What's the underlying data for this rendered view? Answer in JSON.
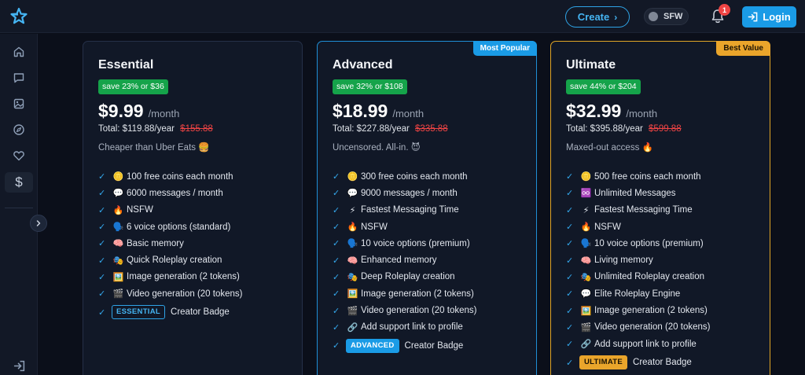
{
  "header": {
    "create_label": "Create",
    "sfw_label": "SFW",
    "notification_count": "1",
    "login_label": "Login"
  },
  "icons": {
    "logo": "star-logo-icon",
    "sidebar": [
      "home-icon",
      "chat-icon",
      "image-icon",
      "compass-icon",
      "heart-icon",
      "dollar-icon"
    ],
    "collapse": "chevron-right-icon",
    "logout": "login-arrow-icon"
  },
  "colors": {
    "accent": "#1a9be6",
    "gold": "#eaa52b",
    "save_green": "#15a34a",
    "strike_red": "#ef4444"
  },
  "plans": [
    {
      "name": "Essential",
      "ribbon": "",
      "save": "save 23% or $36",
      "price": "$9.99",
      "per": "/month",
      "total": "Total: $119.88/year",
      "old_total": "$155.88",
      "tagline": "Cheaper than Uber Eats 🍔",
      "features": [
        {
          "emoji": "🪙",
          "text": "100 free coins each month"
        },
        {
          "emoji": "💬",
          "text": "6000 messages / month"
        },
        {
          "emoji": "🔥",
          "text": "NSFW"
        },
        {
          "emoji": "🗣️",
          "text": "6 voice options (standard)"
        },
        {
          "emoji": "🧠",
          "text": "Basic memory"
        },
        {
          "emoji": "🎭",
          "text": "Quick Roleplay creation"
        },
        {
          "emoji": "🖼️",
          "text": "Image generation (2 tokens)"
        },
        {
          "emoji": "🎬",
          "text": "Video generation (20 tokens)"
        }
      ],
      "badge": "ESSENTIAL",
      "badge_text": "Creator Badge"
    },
    {
      "name": "Advanced",
      "ribbon": "Most Popular",
      "save": "save 32% or $108",
      "price": "$18.99",
      "per": "/month",
      "total": "Total: $227.88/year",
      "old_total": "$335.88",
      "tagline": "Uncensored. All-in. 😈",
      "features": [
        {
          "emoji": "🪙",
          "text": "300 free coins each month"
        },
        {
          "emoji": "💬",
          "text": "9000 messages / month"
        },
        {
          "emoji": "⚡",
          "text": "Fastest Messaging Time"
        },
        {
          "emoji": "🔥",
          "text": "NSFW"
        },
        {
          "emoji": "🗣️",
          "text": "10 voice options (premium)"
        },
        {
          "emoji": "🧠",
          "text": "Enhanced memory"
        },
        {
          "emoji": "🎭",
          "text": "Deep Roleplay creation"
        },
        {
          "emoji": "🖼️",
          "text": "Image generation (2 tokens)"
        },
        {
          "emoji": "🎬",
          "text": "Video generation (20 tokens)"
        },
        {
          "emoji": "🔗",
          "text": "Add support link to profile"
        }
      ],
      "badge": "ADVANCED",
      "badge_text": "Creator Badge"
    },
    {
      "name": "Ultimate",
      "ribbon": "Best Value",
      "save": "save 44% or $204",
      "price": "$32.99",
      "per": "/month",
      "total": "Total: $395.88/year",
      "old_total": "$599.88",
      "tagline": "Maxed-out access 🔥",
      "features": [
        {
          "emoji": "🪙",
          "text": "500 free coins each month"
        },
        {
          "emoji": "♾️",
          "text": "Unlimited Messages"
        },
        {
          "emoji": "⚡",
          "text": "Fastest Messaging Time"
        },
        {
          "emoji": "🔥",
          "text": "NSFW"
        },
        {
          "emoji": "🗣️",
          "text": "10 voice options (premium)"
        },
        {
          "emoji": "🧠",
          "text": "Living memory"
        },
        {
          "emoji": "🎭",
          "text": "Unlimited Roleplay creation"
        },
        {
          "emoji": "💬",
          "text": "Elite Roleplay Engine"
        },
        {
          "emoji": "🖼️",
          "text": "Image generation (2 tokens)"
        },
        {
          "emoji": "🎬",
          "text": "Video generation (20 tokens)"
        },
        {
          "emoji": "🔗",
          "text": "Add support link to profile"
        }
      ],
      "badge": "ULTIMATE",
      "badge_text": "Creator Badge"
    }
  ]
}
